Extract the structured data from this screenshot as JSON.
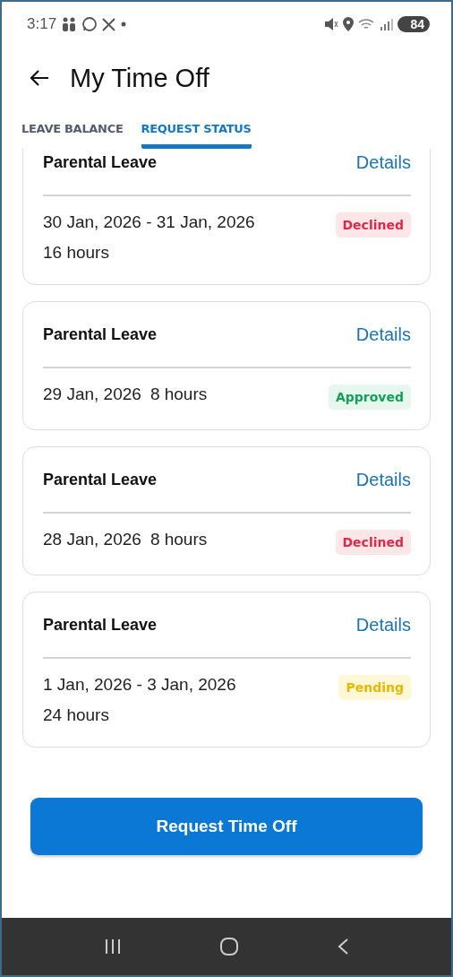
{
  "status_bar": {
    "time": "3:17",
    "battery": "84"
  },
  "header": {
    "title": "My Time Off"
  },
  "tabs": [
    {
      "label": "LEAVE BALANCE",
      "selected": false
    },
    {
      "label": "REQUEST STATUS",
      "selected": true
    }
  ],
  "requests": [
    {
      "kind": "range",
      "type": "Parental Leave",
      "link": "Details",
      "dates": "30 Jan, 2026 - 31 Jan, 2026",
      "hours": "16 hours",
      "status": {
        "label": "Declined",
        "kind": "declined"
      }
    },
    {
      "kind": "single",
      "type": "Parental Leave",
      "link": "Details",
      "dates": "29 Jan, 2026",
      "hours": "8 hours",
      "status": {
        "label": "Approved",
        "kind": "approved"
      }
    },
    {
      "kind": "single",
      "type": "Parental Leave",
      "link": "Details",
      "dates": "28 Jan, 2026",
      "hours": "8 hours",
      "status": {
        "label": "Declined",
        "kind": "declined"
      }
    },
    {
      "kind": "range",
      "type": "Parental Leave",
      "link": "Details",
      "dates": "1 Jan, 2026 - 3 Jan, 2026",
      "hours": "24 hours",
      "status": {
        "label": "Pending",
        "kind": "pending"
      }
    }
  ],
  "action": {
    "label": "Request Time Off"
  }
}
